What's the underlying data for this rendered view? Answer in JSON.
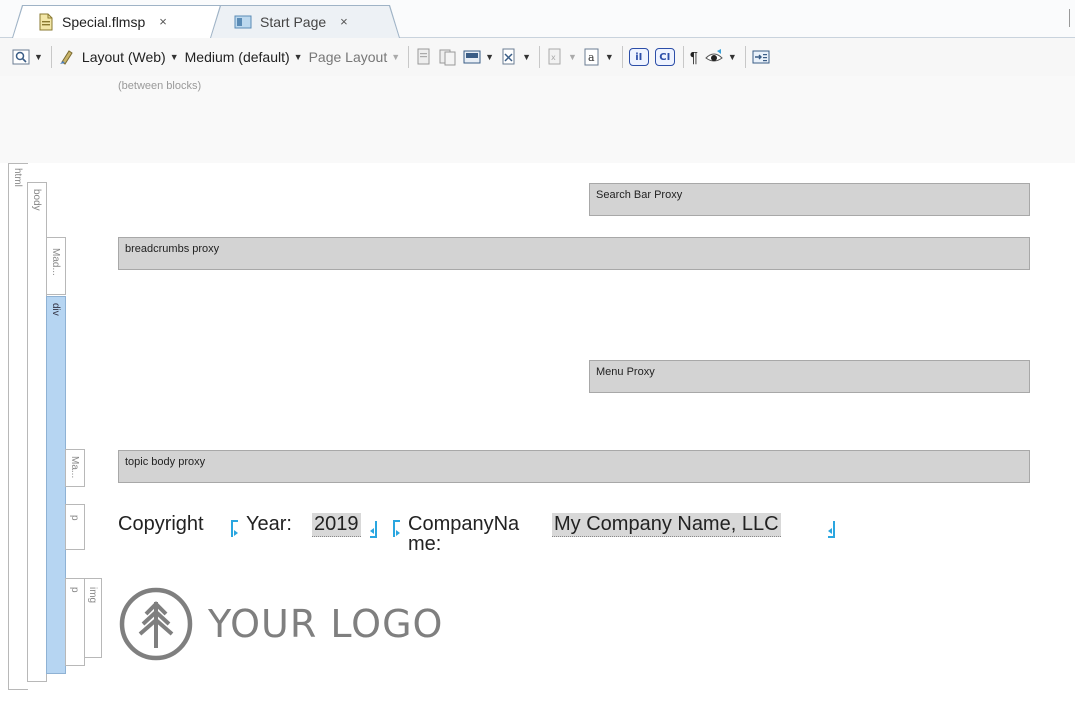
{
  "tabs": [
    {
      "label": "Special.flmsp",
      "close": "×",
      "active": true,
      "icon": "file-icon"
    },
    {
      "label": "Start Page",
      "close": "×",
      "active": false,
      "icon": "start-page-icon"
    }
  ],
  "toolbar": {
    "layout_label": "Layout (Web)",
    "medium_label": "Medium (default)",
    "page_layout_label": "Page Layout",
    "pilcrow": "¶",
    "ii_label": "iI",
    "ci_label": "CI",
    "a_label": "a"
  },
  "editor": {
    "between_blocks": "(between blocks)",
    "structure": {
      "html": "html",
      "body": "body",
      "mad": "Mad...",
      "div": "div",
      "ma": "Ma...",
      "p1": "p",
      "p2": "p",
      "img": "img"
    },
    "proxies": {
      "search": "Search Bar Proxy",
      "breadcrumbs": "breadcrumbs proxy",
      "menu": "Menu Proxy",
      "topic_body": "topic body proxy"
    },
    "copyright": {
      "prefix": "Copyright",
      "year_label": "Year:",
      "year_value": "2019",
      "company_label_1": "CompanyNa",
      "company_label_2": "me:",
      "company_value": "My Company Name, LLC"
    },
    "logo_text": "YOUR LOGO"
  },
  "colors": {
    "div_bar": "#b6d5f2",
    "proxy_bg": "#d3d3d3",
    "bracket": "#2aa6e0",
    "logo_gray": "#7f7f7f"
  }
}
